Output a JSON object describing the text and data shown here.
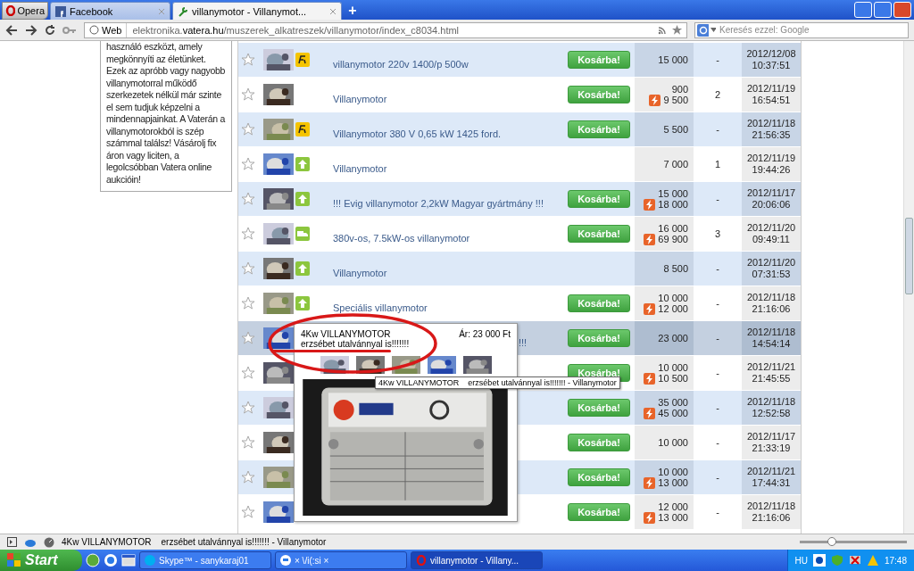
{
  "browser": {
    "menu_button": "Opera",
    "tabs": [
      {
        "label": "Facebook",
        "selected": false,
        "kind": "facebook"
      },
      {
        "label": "villanymotor - Villanymot...",
        "selected": true,
        "kind": "page"
      }
    ],
    "new_tab": "+",
    "address": {
      "badge": "Web",
      "url_prefix": "elektronika.",
      "url_domain": "vatera.hu",
      "url_path": "/muszerek_alkatreszek/villanymotor/index_c8034.html"
    },
    "search": {
      "placeholder": "Keresés ezzel: Google"
    }
  },
  "sidebar": {
    "text": "használó eszközt, amely megkönnyíti az életünket. Ezek az apróbb vagy nagyobb villanymotorral működő szerkezetek nélkül már szinte el sem tudjuk képzelni a mindennapjainkat. A Vaterán a villanymotorokból is szép számmal találsz! Vásárolj fix áron vagy liciten, a legolcsóbban Vatera online aukcióin!"
  },
  "rows": [
    {
      "title": "villanymotor 220v 1400/p 500w",
      "kind": "fix",
      "cart": "Kosárba!",
      "price": "15 000",
      "bids": "-",
      "date": "2012/12/08",
      "time": "10:37:51",
      "highlighted": false
    },
    {
      "title": "Villanymotor",
      "kind": "plain",
      "cart": "Kosárba!",
      "price": "900",
      "buy_now": "9 500",
      "bids": "2",
      "date": "2012/11/19",
      "time": "16:54:51",
      "highlighted": false
    },
    {
      "title": "Villanymotor 380 V 0,65 kW 1425 ford.",
      "kind": "fix",
      "cart": "Kosárba!",
      "price": "5 500",
      "bids": "-",
      "date": "2012/11/18",
      "time": "21:56:35",
      "highlighted": false
    },
    {
      "title": "Villanymotor",
      "kind": "up",
      "price": "7 000",
      "bids": "1",
      "date": "2012/11/19",
      "time": "19:44:26",
      "highlighted": false
    },
    {
      "title": "!!! Evig villanymotor 2,2kW Magyar gyártmány !!!",
      "kind": "up",
      "cart": "Kosárba!",
      "price": "15 000",
      "buy_now": "18 000",
      "bids": "-",
      "date": "2012/11/17",
      "time": "20:06:06",
      "highlighted": false
    },
    {
      "title": "380v-os, 7.5kW-os villanymotor",
      "kind": "truck",
      "cart": "Kosárba!",
      "price": "16 000",
      "buy_now": "69 900",
      "bids": "3",
      "date": "2012/11/20",
      "time": "09:49:11",
      "highlighted": false
    },
    {
      "title": "Villanymotor",
      "kind": "up",
      "price": "8 500",
      "bids": "-",
      "date": "2012/11/20",
      "time": "07:31:53",
      "highlighted": false
    },
    {
      "title": "Speciális villanymotor",
      "kind": "up",
      "cart": "Kosárba!",
      "price": "10 000",
      "buy_now": "12 000",
      "bids": "-",
      "date": "2012/11/18",
      "time": "21:16:06",
      "highlighted": false
    },
    {
      "title": "!!!",
      "kind": "covered",
      "cart": "Kosárba!",
      "price": "23 000",
      "bids": "-",
      "date": "2012/11/18",
      "time": "14:54:14",
      "highlighted": true
    },
    {
      "kind": "covered",
      "cart": "Kosárba!",
      "price": "10 000",
      "buy_now": "10 500",
      "bids": "-",
      "date": "2012/11/21",
      "time": "21:45:55",
      "highlighted": false
    },
    {
      "kind": "covered",
      "cart": "Kosárba!",
      "price": "35 000",
      "buy_now": "45 000",
      "bids": "-",
      "date": "2012/11/18",
      "time": "12:52:58",
      "highlighted": false
    },
    {
      "kind": "covered",
      "cart": "Kosárba!",
      "price": "10 000",
      "bids": "-",
      "date": "2012/11/17",
      "time": "21:33:19",
      "highlighted": false
    },
    {
      "kind": "covered",
      "cart": "Kosárba!",
      "price": "10 000",
      "buy_now": "13 000",
      "bids": "-",
      "date": "2012/11/21",
      "time": "17:44:31",
      "highlighted": false
    },
    {
      "kind": "covered",
      "cart": "Kosárba!",
      "price": "12 000",
      "buy_now": "13 000",
      "bids": "-",
      "date": "2012/11/18",
      "time": "21:16:06",
      "highlighted": false
    }
  ],
  "preview": {
    "title": "4Kw VILLANYMOTOR",
    "subtitle": "erzsébet utalvánnyal is!!!!!!!",
    "price": "Ár: 23 000 Ft"
  },
  "tooltip": "4Kw VILLANYMOTOR    erzsébet utalvánnyal is!!!!!!! - Villanymotor",
  "status_bar": {
    "text": "4Kw VILLANYMOTOR    erzsébet utalvánnyal is!!!!!!! - Villanymotor",
    "zoom": {
      "level": 0.3
    }
  },
  "taskbar": {
    "start": "Start",
    "tasks": [
      {
        "label": "Skype™ - sanykaraj01",
        "selected": false,
        "kind": "skype"
      },
      {
        "label": "× \\/i(:si ×",
        "selected": false,
        "kind": "chat"
      },
      {
        "label": "villanymotor - Villany...",
        "selected": true,
        "kind": "opera"
      }
    ],
    "language": "HU",
    "clock": "17:48"
  }
}
